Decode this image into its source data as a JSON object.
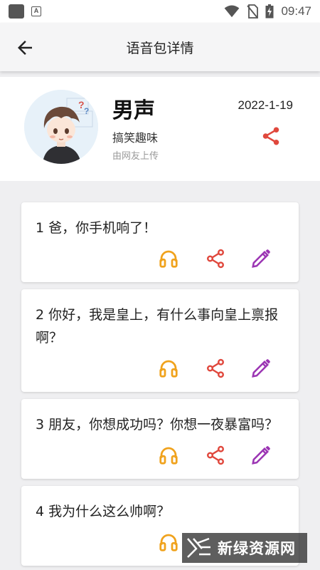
{
  "status_bar": {
    "time": "09:47",
    "icons": [
      "app-square-icon",
      "a-notification-icon",
      "wifi-icon",
      "no-sim-icon",
      "battery-charging-icon"
    ]
  },
  "toolbar": {
    "title": "语音包详情",
    "back_icon": "arrow-left-icon"
  },
  "pack": {
    "name": "男声",
    "category": "搞笑趣味",
    "uploader": "由网友上传",
    "date": "2022-1-19",
    "share_icon": "share-icon"
  },
  "clips": [
    {
      "text": "1  爸，你手机响了！"
    },
    {
      "text": "2  你好，我是皇上，有什么事向皇上禀报啊？"
    },
    {
      "text": "3  朋友，你想成功吗？你想一夜暴富吗？"
    },
    {
      "text": "4  我为什么这么帅啊？"
    }
  ],
  "colors": {
    "listen": "#f0a21c",
    "share": "#e0483d",
    "edit": "#9b34b3"
  },
  "watermark": {
    "text": "新绿资源网"
  }
}
